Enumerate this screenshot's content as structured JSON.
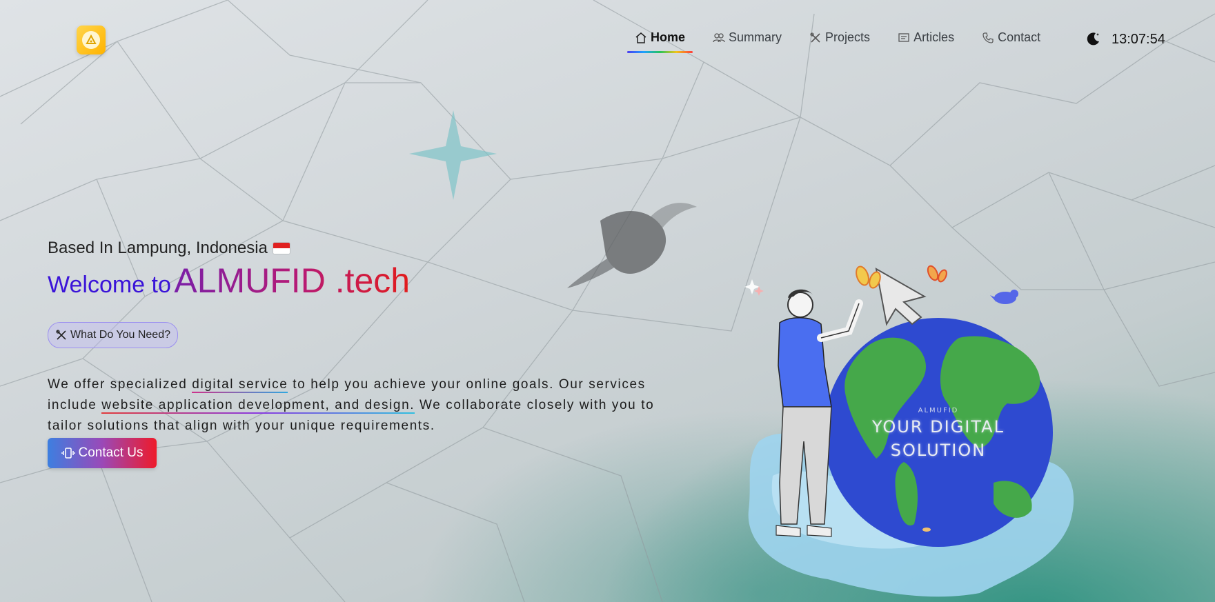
{
  "header": {
    "logo_icon": "logo-icon",
    "nav": [
      {
        "label": "Home",
        "icon": "home-icon",
        "active": true
      },
      {
        "label": "Summary",
        "icon": "users-icon",
        "active": false
      },
      {
        "label": "Projects",
        "icon": "tools-icon",
        "active": false
      },
      {
        "label": "Articles",
        "icon": "article-icon",
        "active": false
      },
      {
        "label": "Contact",
        "icon": "phone-icon",
        "active": false
      }
    ],
    "theme_toggle_icon": "moon-icon",
    "clock": "13:07:54"
  },
  "hero": {
    "based_in": "Based In Lampung, Indonesia",
    "welcome_prefix": "Welcome to",
    "brand": "ALMUFID .tech",
    "badge_label": "What Do You Need?",
    "description": {
      "part1": "We offer specialized ",
      "highlight1": "digital service",
      "part2": " to help you achieve your online goals. Our services include ",
      "highlight2": "website application development, and design.",
      "part3": " We collaborate closely with you to tailor solutions that align with your unique requirements."
    },
    "cta_label": "Contact Us"
  },
  "illustration": {
    "globe_small": "ALMUFID",
    "globe_line1": "YOUR DIGITAL",
    "globe_line2": "SOLUTION"
  },
  "colors": {
    "accent_purple": "#3a13d8",
    "brand_gradient_start": "#7a1fa8",
    "brand_gradient_end": "#e21b1b",
    "cta_gradient_start": "#3d7fe0",
    "cta_gradient_end": "#ee1a2a",
    "globe_ocean": "#2f4fd4",
    "globe_land": "#4caf50"
  }
}
